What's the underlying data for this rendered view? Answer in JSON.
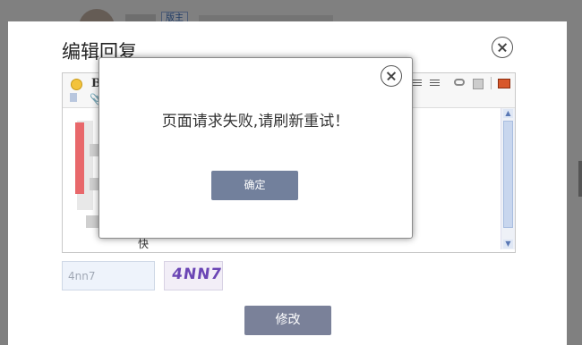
{
  "background": {
    "tag_label": "版主"
  },
  "modal": {
    "title": "编辑回复",
    "editor": {
      "toolbar": {
        "bold_label": "B"
      },
      "content_snippet": "快"
    },
    "captcha": {
      "input_value": "4nn7",
      "image_text": "4NN7"
    },
    "submit_label": "修改"
  },
  "alert": {
    "message": "页面请求失败,请刷新重试！",
    "ok_label": "确定"
  },
  "colors": {
    "primary_button": "#7a8199",
    "overlay": "#000000",
    "captcha_text": "#6b46b5"
  }
}
